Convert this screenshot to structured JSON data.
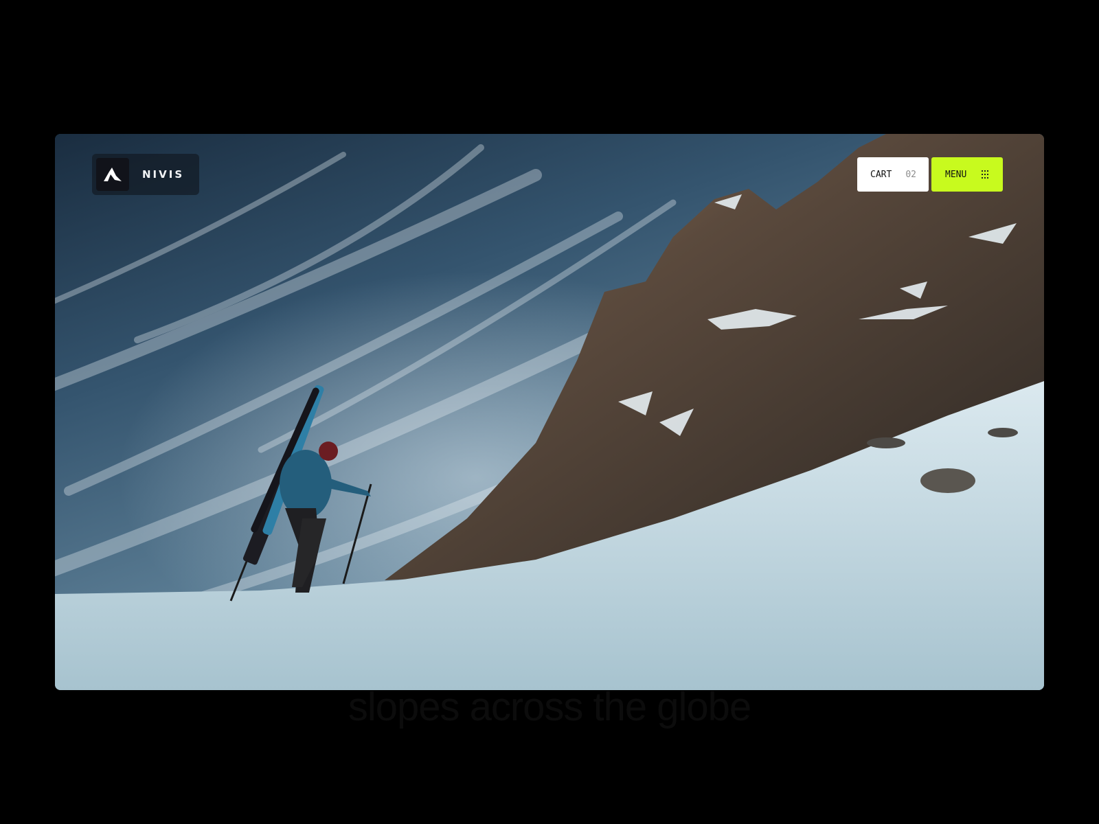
{
  "brand": {
    "name": "NIVIS",
    "logo_icon": "nivis-logo-icon"
  },
  "header": {
    "cart_label": "CART",
    "cart_count": "02",
    "menu_label": "MENU",
    "menu_icon": "grid-dots-icon"
  },
  "colors": {
    "accent": "#c8fa1e",
    "background": "#000000"
  },
  "caption": "slopes across the globe"
}
